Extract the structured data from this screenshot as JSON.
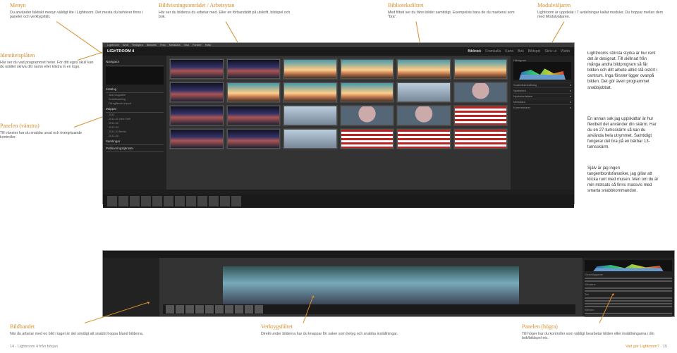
{
  "callouts": {
    "menyn": {
      "title": "Menyn",
      "body": "Du använder faktiskt menyn väldigt lite i Lightroom. Det mesta du behöver finns i paneler och verktygsfält."
    },
    "bildvisning": {
      "title": "Bildvisningsområdet / Arbetsytan",
      "body": "Här ser du bilderna du arbetar med. Eller en förhandstitt på utskrift, bildspel och bok."
    },
    "biblioteksfiltret": {
      "title": "Biblioteksfiltret",
      "body": "Med filtret ser du färre bilder samtidigt. Exempelvis bara de du markerat som \"bra\"."
    },
    "modulvaljaren": {
      "title": "Modulväljaren",
      "body": "Lightroom är uppdelat i 7 avdelningar kallat moduler. Du hoppar mellan dem med Modulväljaren."
    },
    "identitet": {
      "title": "Identitetsplåten",
      "body": "Här ser du vad programmet heter. För ditt egos skull kan du istället skriva ditt namn eller klistra in en logo."
    },
    "panel_v": {
      "title": "Panelen (vänstra)",
      "body": "Till vänster har du snabba urval och övergripande kontroller."
    },
    "bildbandet": {
      "title": "Bildbandet",
      "body": "När du arbetar med en bild i taget är det smidigt att snabbt hoppa bland bilderna."
    },
    "verktyg": {
      "title": "Verktygsfältet",
      "body": "Direkt under bilderna har du knappar för saker som betyg och snabba inställningar."
    },
    "panel_h": {
      "title": "Panelen (högra)",
      "body": "Till höger har du kontroller som väldigt bearbetar bilden eller inställningarna i din bok/bildspel etc."
    }
  },
  "right_text": {
    "p1": "Lightrooms största styrka är hur rent det är designat. Till skillnad från många andra bildprogram så får bilden och ditt arbete alltid stå ostört i centrum. Inga fönster ligger ovanpå bilden. Det gör även programmet snabbjobbat.",
    "p2": "En annan sak jag uppskattar är hur flexibelt det använder din skärm. Har du en 27-tumsskärm så kan du använda hela utrymmet. Samtidigt fungerar det bra på en bärbar 13-tumsskärm.",
    "p3": "Själv är jag ingen tangentbordsfanatiker, jag gillar att klicka runt med musen. Men om du är min motsats så finns massvis med smarta snabbkommandon."
  },
  "lr": {
    "app": "LIGHTROOM 4",
    "menus": [
      "Lightroom",
      "Arkiv",
      "Redigera",
      "Bibliotek",
      "Foto",
      "Metadata",
      "Visa",
      "Fönster",
      "Hjälp"
    ],
    "modules": [
      "Bibliotek",
      "Framkalla",
      "Karta",
      "Bok",
      "Bildspel",
      "Skriv ut",
      "Webb"
    ],
    "left_panel": {
      "nav": "Navigator",
      "catalog_hdr": "Katalog",
      "catalog": [
        "Alla fotografier",
        "Snabbsamling",
        "Föregående import"
      ],
      "folders_hdr": "Mappar",
      "folders": [
        "2012",
        "2012-01 New York",
        "2012-02",
        "2012-03",
        "2012-04 Berlin",
        "2012-05",
        "2012-06"
      ],
      "collections_hdr": "Samlingar",
      "publish_hdr": "Publiceringstjänster"
    },
    "right_panel": {
      "histogram": "Histogram",
      "quick_dev": "Snabbframkallning",
      "keywording": "Nyckelord",
      "keyword_list": "Nyckelordslista",
      "metadata": "Metadata",
      "comments": "Kommentarer"
    },
    "dev_panel": {
      "basic": "Grundläggande",
      "wb": "Vitbalans",
      "tone": "Ton",
      "presence": "Närvaro"
    }
  },
  "footer": {
    "left": "14 · Lightroom 4 från början",
    "right_label": "Vad gör Lightroom?",
    "right_page": " · 15"
  },
  "chart_data": null
}
